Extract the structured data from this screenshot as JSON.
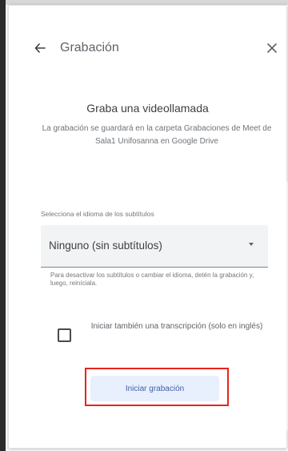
{
  "header": {
    "title": "Grabación"
  },
  "recording": {
    "title": "Graba una videollamada",
    "description": "La grabación se guardará en la carpeta Grabaciones de Meet de Sala1 Unifosanna en Google Drive",
    "language_label": "Selecciona el idioma de los subtítulos",
    "language_value": "Ninguno (sin subtítulos)",
    "help_text": "Para desactivar los subtítulos o cambiar el idioma, detén la grabación y, luego, reiníciala.",
    "transcription_label": "Iniciar también una transcripción (solo en inglés)",
    "transcription_checked": false,
    "start_button": "Iniciar grabación"
  },
  "icons": {
    "back": "arrow-left-icon",
    "close": "close-icon",
    "dropdown": "chevron-down-icon"
  },
  "colors": {
    "accent": "#3f5fa8",
    "button_bg": "#e8f0fe",
    "highlight": "#e8231f",
    "field_bg": "#f1f3f4"
  }
}
